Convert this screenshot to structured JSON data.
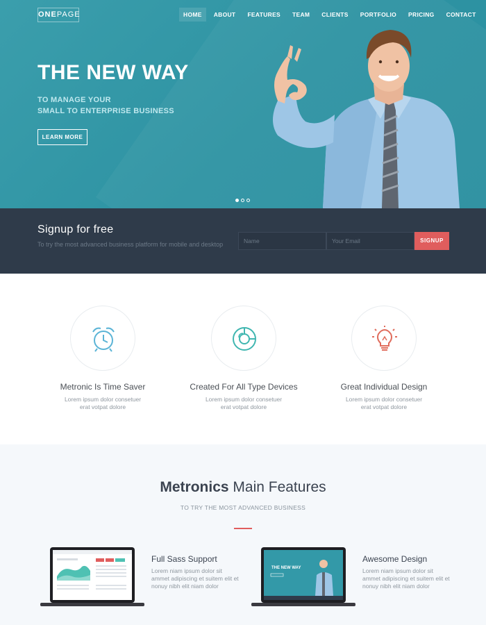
{
  "header": {
    "logo_bold": "ONE",
    "logo_rest": "PAGE",
    "nav": [
      "HOME",
      "ABOUT",
      "FEATURES",
      "TEAM",
      "CLIENTS",
      "PORTFOLIO",
      "PRICING",
      "CONTACT"
    ],
    "active_nav": "HOME"
  },
  "hero": {
    "title": "THE NEW WAY",
    "subtitle_line1": "TO MANAGE YOUR",
    "subtitle_line2": "SMALL TO ENTERPRISE BUSINESS",
    "button": "LEARN MORE",
    "slides": 3,
    "active_slide": 1
  },
  "signup": {
    "title": "Signup for free",
    "description": "To try the most advanced business platform for mobile and desktop",
    "name_placeholder": "Name",
    "email_placeholder": "Your Email",
    "button": "SIGNUP"
  },
  "features": [
    {
      "icon": "alarm-clock-icon",
      "title": "Metronic Is Time Saver",
      "desc_line1": "Lorem ipsum dolor consetuer",
      "desc_line2": "erat votpat dolore",
      "color": "#5bb4d6"
    },
    {
      "icon": "pie-chart-icon",
      "title": "Created For All Type Devices",
      "desc_line1": "Lorem ipsum dolor consetuer",
      "desc_line2": "erat votpat dolore",
      "color": "#3fb6b0"
    },
    {
      "icon": "light-bulb-icon",
      "title": "Great Individual Design",
      "desc_line1": "Lorem ipsum dolor consetuer",
      "desc_line2": "erat votpat dolore",
      "color": "#e06c5c"
    }
  ],
  "main_features": {
    "title_bold": "Metronics",
    "title_rest": " Main Features",
    "subtitle": "TO TRY THE MOST ADVANCED BUSINESS",
    "items": [
      {
        "title": "Full Sass Support",
        "desc": "Lorem niam ipsum dolor sit ammet adipiscing et suitem elit et nonuy nibh elit niam dolor"
      },
      {
        "title": "Awesome Design",
        "desc": "Lorem niam ipsum dolor sit ammet adipiscing et suitem elit et nonuy nibh elit niam dolor"
      }
    ],
    "laptop_screen_title": "THE NEW WAY"
  },
  "colors": {
    "accent": "#e05d5d",
    "hero": "#2e93a3",
    "dark": "#2f3b4a"
  }
}
